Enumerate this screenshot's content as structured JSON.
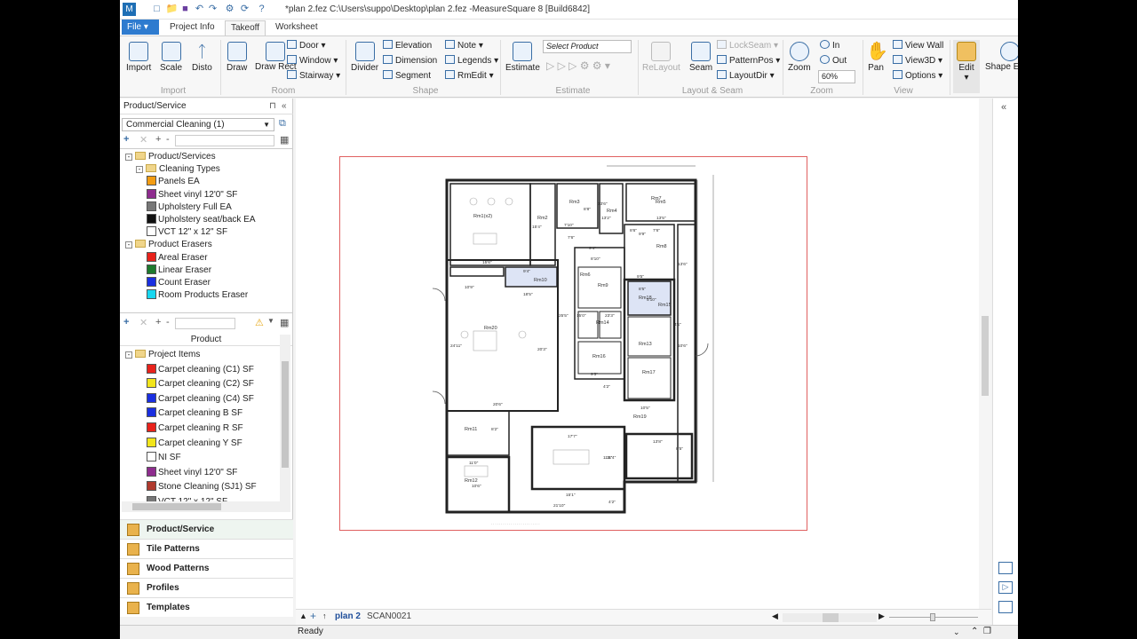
{
  "window": {
    "title": "*plan 2.fez C:\\Users\\suppo\\Desktop\\plan 2.fez -MeasureSquare 8 [Build6842]"
  },
  "ribbon_tabs": {
    "file": "File",
    "project_info": "Project Info",
    "takeoff": "Takeoff",
    "worksheet": "Worksheet"
  },
  "ribbon": {
    "import": {
      "import": "Import",
      "scale": "Scale",
      "disto": "Disto",
      "group": "Import"
    },
    "room": {
      "draw": "Draw",
      "draw_rect": "Draw Rect",
      "door": "Door",
      "window": "Window",
      "stairway": "Stairway",
      "group": "Room"
    },
    "shape": {
      "divider": "Divider",
      "elevation": "Elevation",
      "dimension": "Dimension",
      "segment": "Segment",
      "note": "Note",
      "legends": "Legends",
      "rmedit": "RmEdit",
      "group": "Shape"
    },
    "estimate": {
      "estimate": "Estimate",
      "select_product": "Select Product",
      "group": "Estimate"
    },
    "layout_seam": {
      "relayout": "ReLayout",
      "seam": "Seam",
      "lockseam": "LockSeam",
      "patternpos": "PatternPos",
      "layoutdir": "LayoutDir",
      "group": "Layout & Seam"
    },
    "zoom": {
      "zoom": "Zoom",
      "in": "In",
      "out": "Out",
      "value": "60%",
      "group": "Zoom"
    },
    "view": {
      "pan": "Pan",
      "view_wall": "View Wall",
      "view3d": "View3D",
      "options": "Options",
      "group": "View"
    },
    "edit": {
      "edit": "Edit",
      "shape_edit": "Shape Edit"
    }
  },
  "left_panel": {
    "header": "Product/Service",
    "dropdown": "Commercial Cleaning (1)",
    "tree1": [
      {
        "label": "Product/Services",
        "type": "folder",
        "level": 0
      },
      {
        "label": "Cleaning Types",
        "type": "folder",
        "level": 1
      },
      {
        "label": "Panels  EA",
        "color": "#f39c12",
        "level": 2
      },
      {
        "label": "Sheet vinyl 12'0\" SF",
        "color": "#8e2c8e",
        "level": 2
      },
      {
        "label": "Upholstery Full  EA",
        "color": "#777777",
        "level": 2
      },
      {
        "label": "Upholstery seat/back  EA",
        "color": "#111111",
        "level": 2
      },
      {
        "label": "VCT 12\" x 12\" SF",
        "color": "#ffffff",
        "level": 2
      },
      {
        "label": "Product Erasers",
        "type": "folder",
        "level": 0
      },
      {
        "label": "Areal Eraser",
        "color": "#e8221b",
        "level": 2
      },
      {
        "label": "Linear Eraser",
        "color": "#1e7a2e",
        "level": 2
      },
      {
        "label": "Count Eraser",
        "color": "#1a2fe0",
        "level": 2
      },
      {
        "label": "Room Products Eraser",
        "color": "#18d7f0",
        "level": 2
      }
    ],
    "product_header": "Product",
    "tree2": [
      {
        "label": "Project Items",
        "type": "folder",
        "level": 0
      },
      {
        "label": "Carpet cleaning (C1)  SF",
        "color": "#e8221b",
        "level": 2
      },
      {
        "label": "Carpet cleaning (C2)  SF",
        "color": "#f2e51b",
        "level": 2
      },
      {
        "label": "Carpet cleaning (C4)  SF",
        "color": "#1a2fe0",
        "level": 2
      },
      {
        "label": "Carpet cleaning B  SF",
        "color": "#1a2fe0",
        "level": 2
      },
      {
        "label": "Carpet cleaning R  SF",
        "color": "#e8221b",
        "level": 2
      },
      {
        "label": "Carpet cleaning Y  SF",
        "color": "#f2e51b",
        "level": 2
      },
      {
        "label": "NI  SF",
        "color": "#ffffff",
        "level": 2
      },
      {
        "label": "Sheet vinyl 12'0\" SF",
        "color": "#8e2c8e",
        "level": 2
      },
      {
        "label": "Stone Cleaning (SJ1)  SF",
        "color": "#b03a2e",
        "level": 2
      },
      {
        "label": "VCT 12\" x 12\" SF",
        "color": "#777777",
        "level": 2
      }
    ],
    "nav": [
      "Product/Service",
      "Tile Patterns",
      "Wood Patterns",
      "Profiles",
      "Templates"
    ]
  },
  "plan_labels": {
    "rooms": [
      "Rm1(x2)",
      "Rm2",
      "Rm3",
      "Rm4",
      "Rm5",
      "Rm6",
      "Rm7",
      "Rm8",
      "Rm9",
      "Rm10",
      "Rm11",
      "Rm12",
      "Rm13",
      "Rm14",
      "Rm15",
      "Rm16",
      "Rm17",
      "Rm18",
      "Rm19",
      "Rm20"
    ],
    "dims": [
      "15'6\"",
      "15'4\"",
      "13'6\"",
      "8'8\"",
      "7'10\"",
      "7'6\"",
      "13'2\"",
      "13'5\"",
      "7'6\"",
      "8'6\"",
      "10'9\"",
      "9'4\"",
      "8'10\"",
      "9'5\"",
      "8'5\"",
      "5'10\"",
      "20'6\"",
      "24'11\"",
      "20'3\"",
      "25'5\"",
      "15'0\"",
      "23'3\"",
      "9'5\"",
      "9'9\"",
      "4'2\"",
      "10'5\"",
      "4'1\"",
      "13'8\"",
      "8'5\"",
      "13'6\"",
      "10'6\"",
      "11'8\"",
      "8'2\"",
      "17'7\"",
      "11'4\"",
      "15'1\"",
      "11'0\"",
      "10'6\"",
      "21'10\"",
      "4'2\"",
      "18'5\"",
      "9'4\""
    ]
  },
  "bottom": {
    "sheet_tab": "plan 2",
    "sheet_tab2": "SCAN0021"
  },
  "status": {
    "text": "Ready"
  }
}
